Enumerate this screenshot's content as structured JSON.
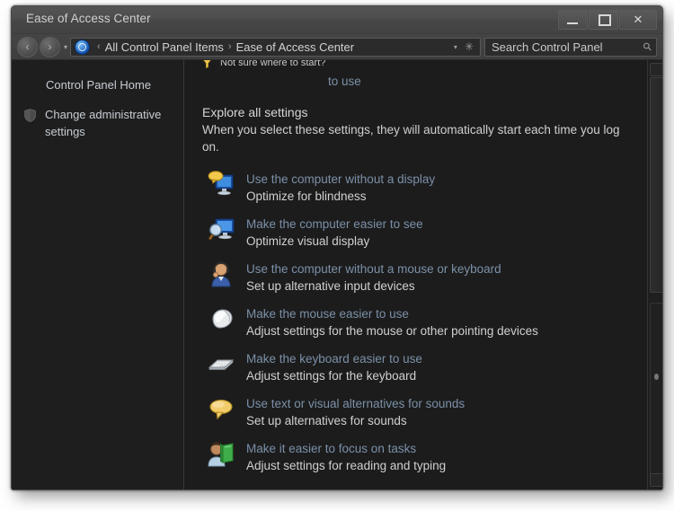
{
  "window": {
    "title": "Ease of Access Center",
    "minimize_label": "Minimize",
    "maximize_label": "Maximize",
    "close_label": "Close"
  },
  "navbar": {
    "back_label": "‹",
    "forward_label": "›",
    "history_caret": "▾",
    "control_panel_icon": "control-panel-icon",
    "breadcrumb_leading_sep": "‹",
    "breadcrumbs": [
      {
        "label": "All Control Panel Items",
        "separator": "›"
      },
      {
        "label": "Ease of Access Center",
        "separator": ""
      }
    ],
    "address_caret": "▾",
    "refresh_glyph": "✳",
    "search": {
      "placeholder": "Search Control Panel",
      "value": "",
      "icon": "search-icon"
    }
  },
  "sidebar": {
    "items": [
      {
        "label": "Control Panel Home",
        "icon": ""
      },
      {
        "label": "Change administrative settings",
        "icon": "shield-icon"
      }
    ]
  },
  "content": {
    "hint": {
      "icon": "funnel-icon",
      "text": "Not sure where to start?"
    },
    "top_link_fragment": "to use",
    "explore_title": "Explore all settings",
    "explore_description": "When you select these settings, they will automatically start each time you log on.",
    "settings": [
      {
        "icon": "monitor-narrator-icon",
        "link": "Use the computer without a display",
        "description": "Optimize for blindness"
      },
      {
        "icon": "monitor-magnifier-icon",
        "link": "Make the computer easier to see",
        "description": "Optimize visual display"
      },
      {
        "icon": "person-headset-icon",
        "link": "Use the computer without a mouse or keyboard",
        "description": "Set up alternative input devices"
      },
      {
        "icon": "mouse-icon",
        "link": "Make the mouse easier to use",
        "description": "Adjust settings for the mouse or other pointing devices"
      },
      {
        "icon": "keyboard-icon",
        "link": "Make the keyboard easier to use",
        "description": "Adjust settings for the keyboard"
      },
      {
        "icon": "speech-bubble-icon",
        "link": "Use text or visual alternatives for sounds",
        "description": "Set up alternatives for sounds"
      },
      {
        "icon": "person-book-icon",
        "link": "Make it easier to focus on tasks",
        "description": "Adjust settings for reading and typing"
      }
    ]
  },
  "colors": {
    "link": "#7b90a8",
    "body_text": "#d0d0d0",
    "window_background": "#1c1c1c",
    "titlebar": "#4a4a4a",
    "accent_yellow": "#f0c850"
  }
}
